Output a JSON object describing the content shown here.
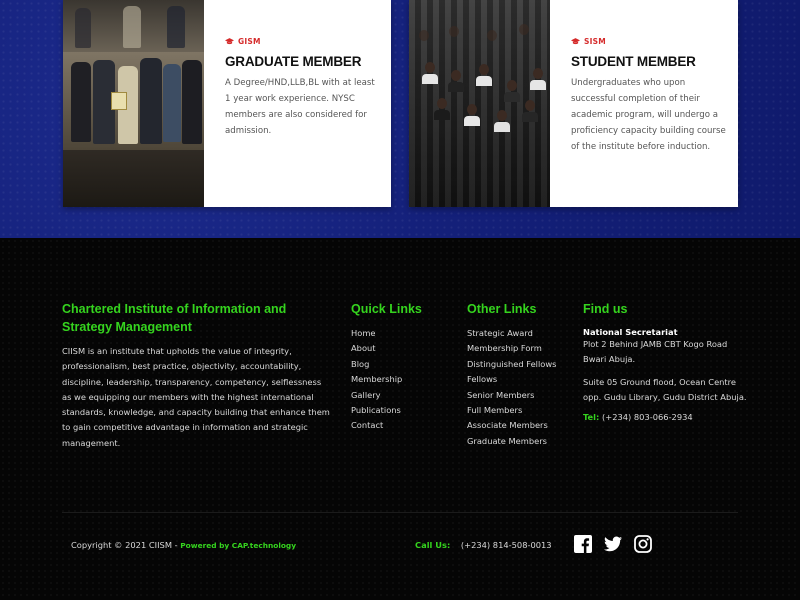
{
  "cards": [
    {
      "tag": "GISM",
      "title": "GRADUATE MEMBER",
      "text": "A Degree/HND,LLB,BL with at least 1 year work experience. NYSC members are also considered for admission."
    },
    {
      "tag": "SISM",
      "title": "STUDENT MEMBER",
      "text": "Undergraduates who upon successful completion of their academic program, will undergo a proficiency capacity building course of the institute before induction."
    }
  ],
  "footer": {
    "about": {
      "heading": "Chartered Institute of Information and Strategy Management",
      "text": "CIISM is an institute that upholds the value of integrity, professionalism, best practice, objectivity, accountability, discipline, leadership, transparency, competency, selflessness as we equipping our members with the highest international standards, knowledge, and capacity building that enhance them to gain competitive advantage in information and strategic management."
    },
    "quick_links": {
      "heading": "Quick Links",
      "items": [
        "Home",
        "About",
        "Blog",
        "Membership",
        "Gallery",
        "Publications",
        "Contact"
      ]
    },
    "other_links": {
      "heading": "Other Links",
      "items": [
        "Strategic Award",
        "Membership Form",
        "Distinguished Fellows",
        "Fellows",
        "Senior Members",
        "Full Members",
        "Associate Members",
        "Graduate Members"
      ]
    },
    "find_us": {
      "heading": "Find us",
      "subheading": "National Secretariat",
      "address1": "Plot 2 Behind JAMB CBT Kogo Road Bwari Abuja.",
      "address2": "Suite 05 Ground flood, Ocean Centre opp. Gudu Library, Gudu District Abuja.",
      "tel_label": "Tel:",
      "tel_value": "(+234) 803-066-2934"
    },
    "bottom": {
      "copyright": "Copyright © 2021 CIISM - ",
      "powered": "Powered by CAP.technology",
      "call_label": "Call Us:",
      "call_value": "(+234) 814-508-0013"
    },
    "social_icons": [
      "facebook-icon",
      "twitter-icon",
      "instagram-icon"
    ]
  },
  "colors": {
    "accent_green": "#35d41e",
    "tag_red": "#d52b2b",
    "band_blue": "#14207a",
    "footer_bg": "#050505"
  }
}
